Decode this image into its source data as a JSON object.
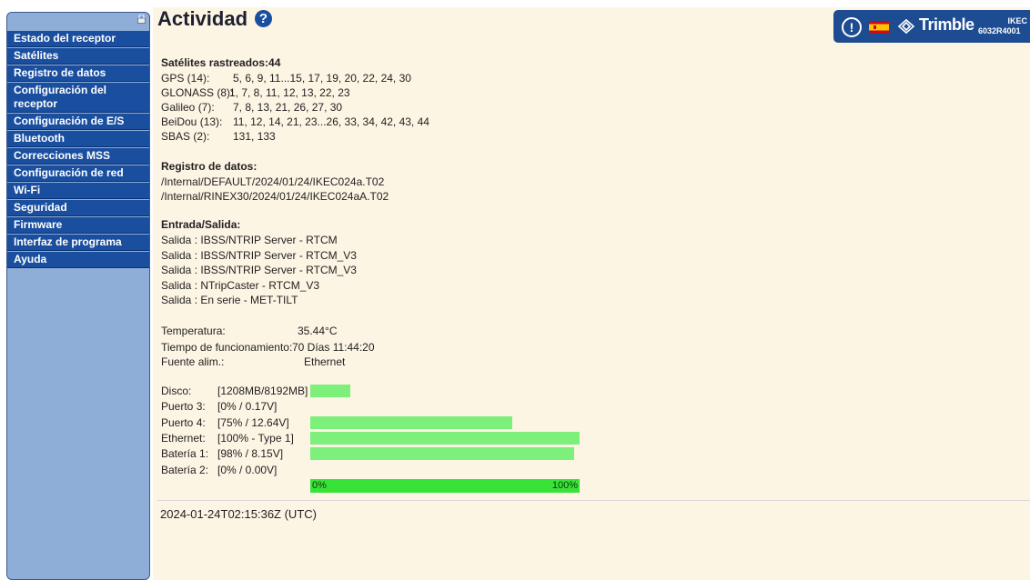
{
  "sidebar": {
    "items": [
      {
        "label": "Estado del receptor"
      },
      {
        "label": "Satélites"
      },
      {
        "label": "Registro de datos"
      },
      {
        "label": "Configuración del receptor"
      },
      {
        "label": "Configuración de E/S"
      },
      {
        "label": "Bluetooth"
      },
      {
        "label": "Correcciones MSS"
      },
      {
        "label": "Configuración de red"
      },
      {
        "label": "Wi-Fi"
      },
      {
        "label": "Seguridad"
      },
      {
        "label": "Firmware"
      },
      {
        "label": "Interfaz de programa"
      },
      {
        "label": "Ayuda"
      }
    ]
  },
  "header": {
    "title": "Actividad",
    "help_icon": "?",
    "alert_icon": "!",
    "brand": "Trimble",
    "model_line1": "IKEC",
    "model_line2": "6032R4001"
  },
  "satellites": {
    "title": "Satélites rastreados:44",
    "rows": [
      {
        "label": "GPS (14):",
        "value": "5, 6, 9, 11...15, 17, 19, 20, 22, 24, 30"
      },
      {
        "label": "GLONASS (8):",
        "value": "1, 7, 8, 11, 12, 13, 22, 23"
      },
      {
        "label": "Galileo (7):",
        "value": "7, 8, 13, 21, 26, 27, 30"
      },
      {
        "label": "BeiDou (13):",
        "value": "11, 12, 14, 21, 23...26, 33, 34, 42, 43, 44"
      },
      {
        "label": "SBAS (2):",
        "value": "131, 133"
      }
    ]
  },
  "logging": {
    "title": "Registro de datos:",
    "files": [
      "/Internal/DEFAULT/2024/01/24/IKEC024a.T02",
      "/Internal/RINEX30/2024/01/24/IKEC024aA.T02"
    ]
  },
  "io": {
    "title": "Entrada/Salida:",
    "outputs": [
      "Salida : IBSS/NTRIP Server - RTCM",
      "Salida : IBSS/NTRIP Server - RTCM_V3",
      "Salida : IBSS/NTRIP Server - RTCM_V3",
      "Salida : NTripCaster - RTCM_V3",
      "Salida : En serie - MET-TILT"
    ]
  },
  "status": {
    "temperature_label": "Temperatura:",
    "temperature_value": "35.44°C",
    "uptime_label": "Tiempo de funcionamiento:",
    "uptime_value": "70 Días 11:44:20",
    "power_label": "Fuente alim.:",
    "power_value": "Ethernet"
  },
  "resources": [
    {
      "label": "Disco:",
      "value": "[1208MB/8192MB]",
      "level": 0.147
    },
    {
      "label": "Puerto 3:",
      "value": "[0% / 0.17V]",
      "level": 0
    },
    {
      "label": "Puerto 4:",
      "value": "[75% / 12.64V]",
      "level": 0.75
    },
    {
      "label": "Ethernet:",
      "value": "[100% - Type 1]",
      "level": 1.0
    },
    {
      "label": "Batería 1:",
      "value": "[98% / 8.15V]",
      "level": 0.98
    },
    {
      "label": "Batería 2:",
      "value": "[0% / 0.00V]",
      "level": 0
    }
  ],
  "scale": {
    "min": "0%",
    "max": "100%"
  },
  "timestamp": "2024-01-24T02:15:36Z (UTC)",
  "colors": {
    "nav_bg": "#1a4fa0",
    "sidebar_bg": "#8eaed8",
    "page_bg": "#fdf5e4",
    "bar": "#7cf07a",
    "scale_bar": "#39e239"
  }
}
